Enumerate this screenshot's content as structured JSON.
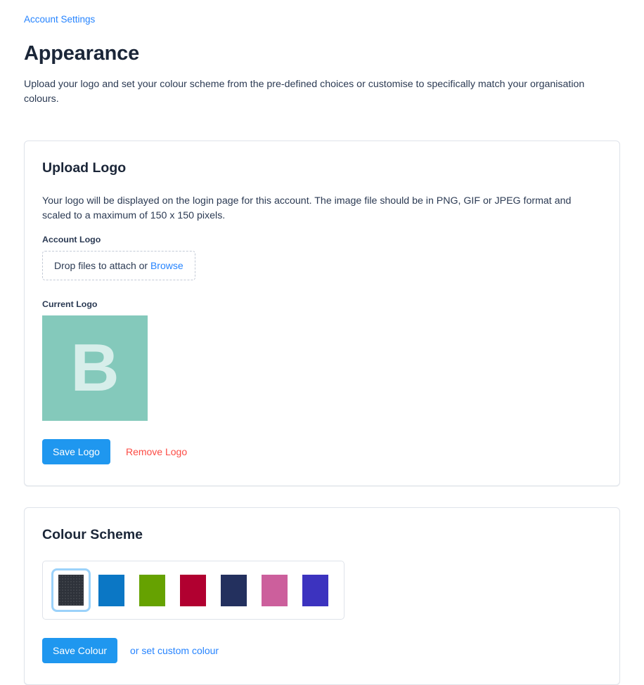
{
  "breadcrumb": {
    "label": "Account Settings"
  },
  "header": {
    "title": "Appearance",
    "intro": "Upload your logo and set your colour scheme from the pre-defined choices or customise to specifically match your organisation colours."
  },
  "upload_logo_card": {
    "title": "Upload Logo",
    "description": "Your logo will be displayed on the login page for this account. The image file should be in PNG, GIF or JPEG format and scaled to a maximum of 150 x 150 pixels.",
    "account_logo_label": "Account Logo",
    "dropzone": {
      "text": "Drop files to attach or",
      "browse_label": "Browse"
    },
    "current_logo_label": "Current Logo",
    "current_logo": {
      "glyph": "B",
      "background_color": "#84c9bb",
      "glyph_color": "#d7eeea",
      "size": "150 x 150"
    },
    "save_label": "Save Logo",
    "remove_label": "Remove Logo"
  },
  "colour_scheme_card": {
    "title": "Colour Scheme",
    "swatches": [
      {
        "name": "charcoal",
        "color": "#2e323a",
        "selected": true
      },
      {
        "name": "blue",
        "color": "#0b77c5",
        "selected": false
      },
      {
        "name": "green",
        "color": "#66a201",
        "selected": false
      },
      {
        "name": "crimson",
        "color": "#b10030",
        "selected": false
      },
      {
        "name": "navy",
        "color": "#23305e",
        "selected": false
      },
      {
        "name": "pink",
        "color": "#cc5f9c",
        "selected": false
      },
      {
        "name": "purple",
        "color": "#3c33bf",
        "selected": false
      }
    ],
    "save_label": "Save Colour",
    "custom_link_label": "or set custom colour"
  },
  "theme": {
    "accent": "#1f97ef",
    "link": "#2684ff",
    "danger": "#fc4b44",
    "text": "#2b3a53",
    "heading": "#1b2638",
    "border": "#dfe3ea"
  }
}
